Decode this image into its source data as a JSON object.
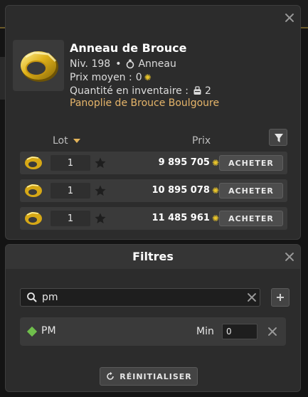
{
  "item": {
    "name": "Anneau de Brouce",
    "level": "Niv. 198",
    "separator": "•",
    "type": "Anneau",
    "avg_price_label": "Prix moyen :",
    "avg_price_value": "0",
    "inventory_label": "Quantité en inventaire :",
    "inventory_value": "2",
    "set_name": "Panoplie de Brouce Boulgoure"
  },
  "table": {
    "col_lot": "Lot",
    "col_price": "Prix",
    "rows": [
      {
        "qty": "1",
        "price": "9 895 705",
        "buy_label": "ACHETER"
      },
      {
        "qty": "1",
        "price": "10 895 078",
        "buy_label": "ACHETER"
      },
      {
        "qty": "1",
        "price": "11 485 961",
        "buy_label": "ACHETER"
      }
    ]
  },
  "filters": {
    "title": "Filtres",
    "search_value": "pm",
    "rows": [
      {
        "name": "PM",
        "min_label": "Min",
        "min_value": "0"
      }
    ],
    "reset_label": "RÉINITIALISER"
  },
  "colors": {
    "panel_bg": "#2c2c2c",
    "row_bg": "#3a3a3a",
    "set_name": "#e6b56a",
    "kama": "#e8c42a",
    "stat_diamond": "#6fbf4c"
  },
  "icons": {
    "ring": "ring-icon",
    "kama": "kama-icon",
    "star": "star-icon",
    "filter": "funnel-icon",
    "search": "search-icon",
    "reset": "reset-icon"
  }
}
